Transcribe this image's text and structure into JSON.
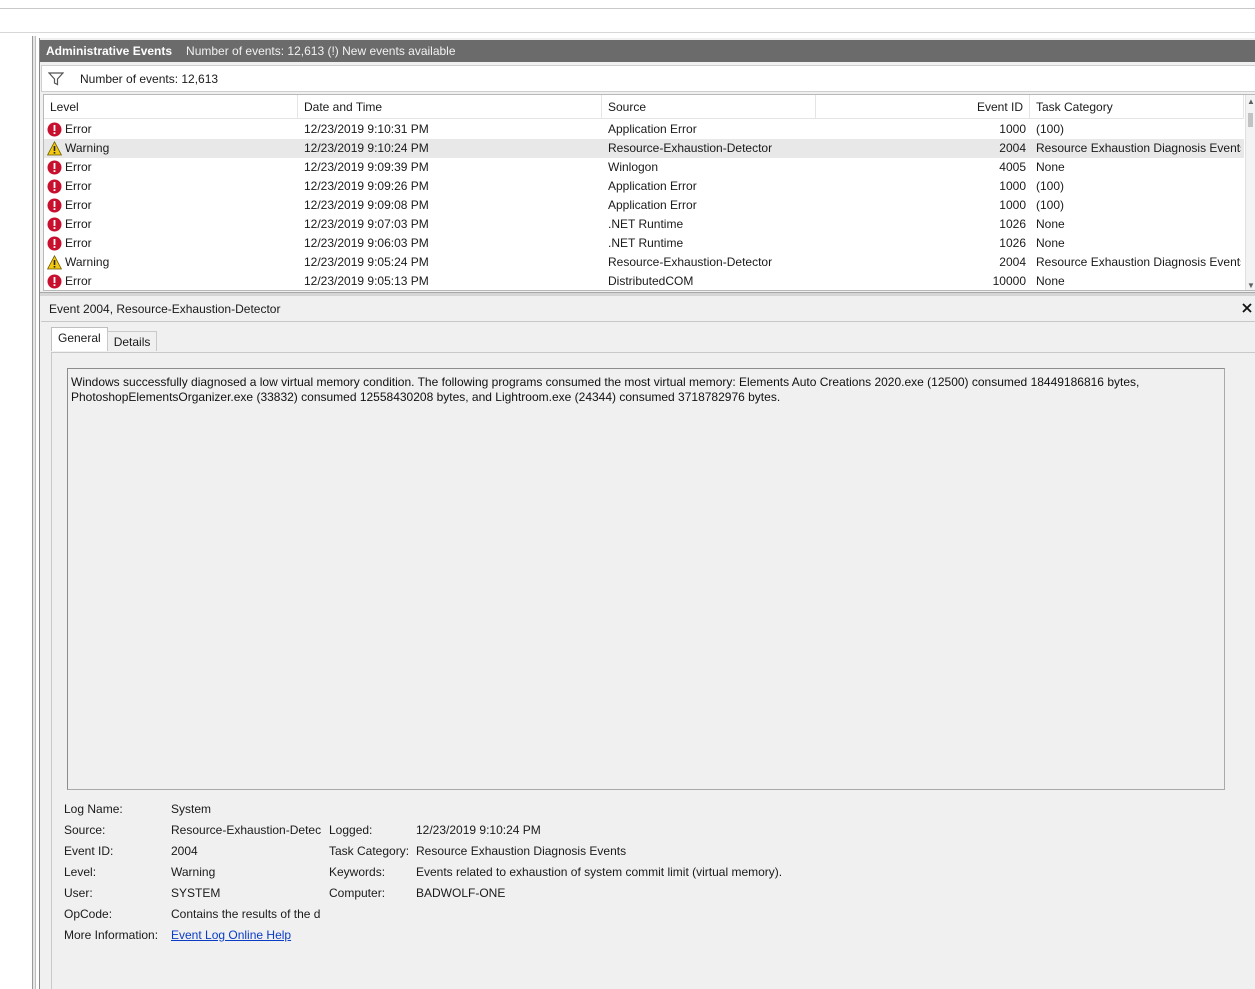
{
  "header": {
    "title": "Administrative Events",
    "info": "Number of events: 12,613 (!) New events available"
  },
  "filter": {
    "icon": "filter-icon",
    "text": "Number of events: 12,613"
  },
  "grid": {
    "columns": {
      "level": "Level",
      "date": "Date and Time",
      "source": "Source",
      "eventid": "Event ID",
      "task": "Task Category"
    },
    "rows": [
      {
        "level": "Error",
        "icon": "error-icon",
        "date": "12/23/2019 9:10:31 PM",
        "source": "Application Error",
        "eventid": "1000",
        "task": "(100)"
      },
      {
        "level": "Warning",
        "icon": "warning-icon",
        "date": "12/23/2019 9:10:24 PM",
        "source": "Resource-Exhaustion-Detector",
        "eventid": "2004",
        "task": "Resource Exhaustion Diagnosis Events"
      },
      {
        "level": "Error",
        "icon": "error-icon",
        "date": "12/23/2019 9:09:39 PM",
        "source": "Winlogon",
        "eventid": "4005",
        "task": "None"
      },
      {
        "level": "Error",
        "icon": "error-icon",
        "date": "12/23/2019 9:09:26 PM",
        "source": "Application Error",
        "eventid": "1000",
        "task": "(100)"
      },
      {
        "level": "Error",
        "icon": "error-icon",
        "date": "12/23/2019 9:09:08 PM",
        "source": "Application Error",
        "eventid": "1000",
        "task": "(100)"
      },
      {
        "level": "Error",
        "icon": "error-icon",
        "date": "12/23/2019 9:07:03 PM",
        "source": ".NET Runtime",
        "eventid": "1026",
        "task": "None"
      },
      {
        "level": "Error",
        "icon": "error-icon",
        "date": "12/23/2019 9:06:03 PM",
        "source": ".NET Runtime",
        "eventid": "1026",
        "task": "None"
      },
      {
        "level": "Warning",
        "icon": "warning-icon",
        "date": "12/23/2019 9:05:24 PM",
        "source": "Resource-Exhaustion-Detector",
        "eventid": "2004",
        "task": "Resource Exhaustion Diagnosis Events"
      },
      {
        "level": "Error",
        "icon": "error-icon",
        "date": "12/23/2019 9:05:13 PM",
        "source": "DistributedCOM",
        "eventid": "10000",
        "task": "None"
      }
    ]
  },
  "detail": {
    "title": "Event 2004, Resource-Exhaustion-Detector",
    "tabs": {
      "general": "General",
      "details": "Details"
    },
    "description": "Windows successfully diagnosed a low virtual memory condition. The following programs consumed the most virtual memory: Elements Auto Creations 2020.exe (12500) consumed 18449186816 bytes, PhotoshopElementsOrganizer.exe (33832) consumed 12558430208 bytes, and Lightroom.exe (24344) consumed 3718782976 bytes.",
    "props": {
      "log_name_label": "Log Name:",
      "log_name": "System",
      "source_label": "Source:",
      "source": "Resource-Exhaustion-Detect",
      "logged_label": "Logged:",
      "logged": "12/23/2019 9:10:24 PM",
      "event_id_label": "Event ID:",
      "event_id": "2004",
      "task_category_label": "Task Category:",
      "task_category": "Resource Exhaustion Diagnosis Events",
      "level_label": "Level:",
      "level": "Warning",
      "keywords_label": "Keywords:",
      "keywords": "Events related to exhaustion of system commit limit (virtual memory).",
      "user_label": "User:",
      "user": "SYSTEM",
      "computer_label": "Computer:",
      "computer": "BADWOLF-ONE",
      "opcode_label": "OpCode:",
      "opcode": "Contains the results of the d",
      "more_info_label": "More Information:",
      "more_info_link": "Event Log Online Help"
    }
  },
  "colors": {
    "header_bg": "#6b6b6b",
    "error_red": "#c8102e",
    "warning_yellow": "#f2c811",
    "link_blue": "#0b3cc5",
    "selected_row": "#e8e8e8"
  }
}
